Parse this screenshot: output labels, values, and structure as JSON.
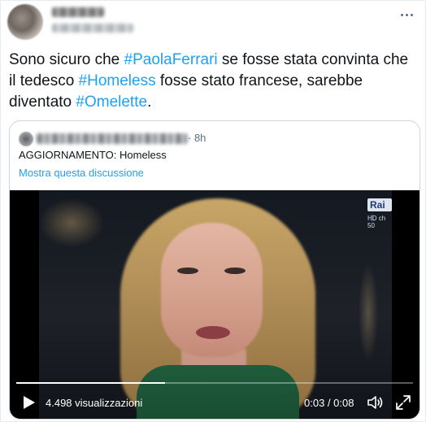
{
  "tweet": {
    "text_parts": [
      {
        "text": "Sono sicuro che ",
        "hashtag": false
      },
      {
        "text": "#PaolaFerrari",
        "hashtag": true
      },
      {
        "text": " se fosse stata convinta che il tedesco ",
        "hashtag": false
      },
      {
        "text": "#Homeless",
        "hashtag": true
      },
      {
        "text": " fosse stato francese, sarebbe diventato ",
        "hashtag": false
      },
      {
        "text": "#Omelette",
        "hashtag": true
      },
      {
        "text": ".",
        "hashtag": false
      }
    ]
  },
  "quoted": {
    "time": "· 8h",
    "text": "AGGIORNAMENTO: Homeless",
    "show_thread": "Mostra questa discussione"
  },
  "video": {
    "channel_logo": "Rai 1",
    "hd_badge": "HD ch 50",
    "views": "4.498 visualizzazioni",
    "time": "0:03 / 0:08",
    "progress": 0.375
  },
  "icons": {
    "more": "more-icon",
    "play": "play-icon",
    "volume": "volume-icon",
    "fullscreen": "fullscreen-icon"
  },
  "colors": {
    "hashtag": "#1da1f2",
    "secondary_text": "#5b7083",
    "border": "#ccd6dd"
  }
}
